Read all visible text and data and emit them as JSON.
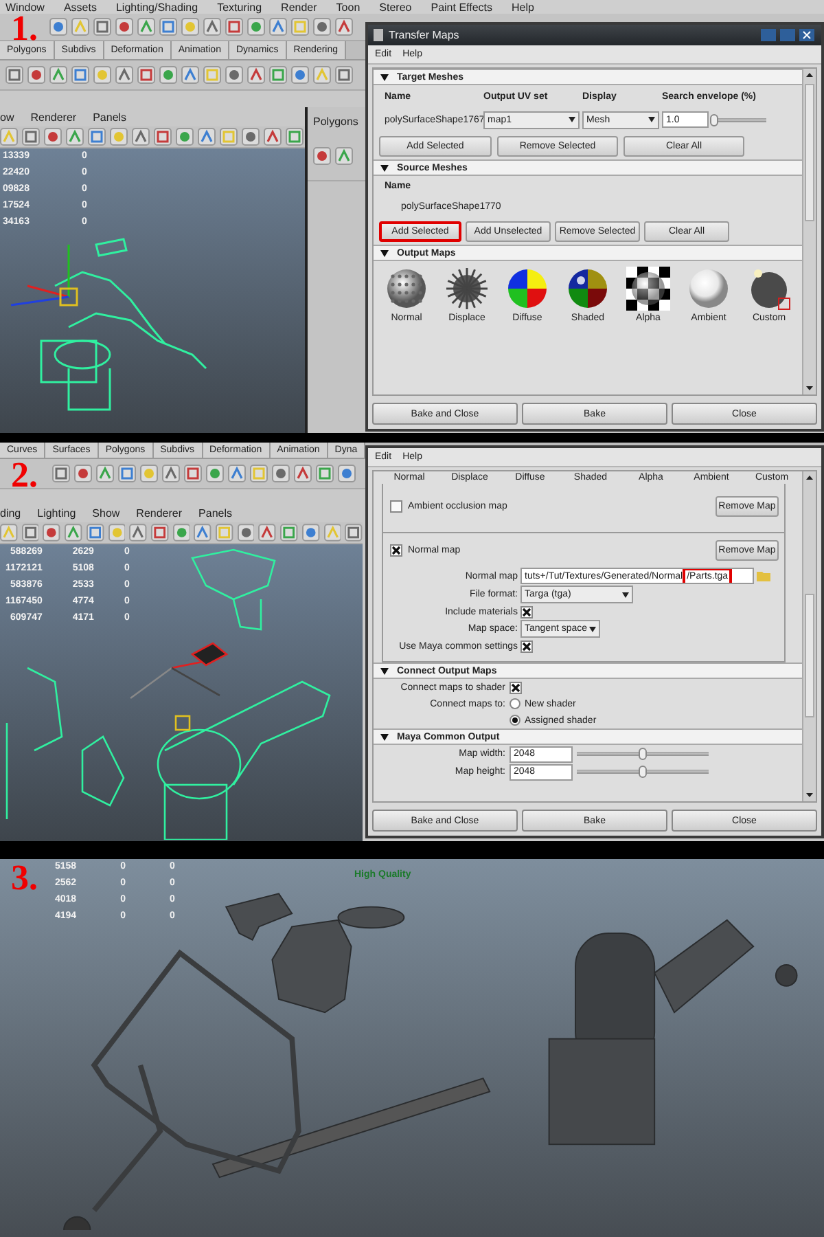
{
  "step_1": {
    "step": "1.",
    "menu_bar": [
      "Window",
      "Assets",
      "Lighting/Shading",
      "Texturing",
      "Render",
      "Toon",
      "Stereo",
      "Paint Effects",
      "Help"
    ],
    "shelf_tabs": [
      "Polygons",
      "Subdivs",
      "Deformation",
      "Animation",
      "Dynamics",
      "Rendering"
    ],
    "viewport_menu": [
      "ow",
      "Renderer",
      "Panels"
    ],
    "stats": [
      [
        "13339",
        "0"
      ],
      [
        "22420",
        "0"
      ],
      [
        "09828",
        "0"
      ],
      [
        "17524",
        "0"
      ],
      [
        "34163",
        "0"
      ]
    ],
    "side_panel": {
      "title": "Polygons"
    },
    "dialog": {
      "title": "Transfer Maps",
      "menu": [
        "Edit",
        "Help"
      ],
      "target": {
        "heading": "Target Meshes",
        "columns": [
          "Name",
          "Output UV set",
          "Display",
          "Search envelope (%)"
        ],
        "mesh": "polySurfaceShape1767",
        "uv_set": "map1",
        "display": "Mesh",
        "envelope": "1.0",
        "envelope_slider": {
          "level": 0.05
        },
        "buttons": [
          {
            "label": "Add Selected",
            "highlighted": false
          },
          {
            "label": "Remove Selected",
            "highlighted": false
          },
          {
            "label": "Clear All",
            "highlighted": false
          }
        ]
      },
      "source": {
        "heading": "Source Meshes",
        "column": "Name",
        "mesh": "polySurfaceShape1770",
        "buttons": [
          {
            "label": "Add Selected",
            "highlighted": true
          },
          {
            "label": "Add Unselected",
            "highlighted": false
          },
          {
            "label": "Remove Selected",
            "highlighted": false
          },
          {
            "label": "Clear All",
            "highlighted": false
          }
        ]
      },
      "output": {
        "heading": "Output Maps",
        "maps": [
          {
            "label": "Normal",
            "kind": "normal"
          },
          {
            "label": "Displace",
            "kind": "displace"
          },
          {
            "label": "Diffuse",
            "kind": "diffuse"
          },
          {
            "label": "Shaded",
            "kind": "shaded"
          },
          {
            "label": "Alpha",
            "kind": "alpha"
          },
          {
            "label": "Ambient",
            "kind": "ambient"
          },
          {
            "label": "Custom",
            "kind": "custom"
          }
        ]
      },
      "footer": [
        "Bake and Close",
        "Bake",
        "Close"
      ]
    }
  },
  "step_2": {
    "step": "2.",
    "shelf_tabs": [
      "Curves",
      "Surfaces",
      "Polygons",
      "Subdivs",
      "Deformation",
      "Animation",
      "Dyna"
    ],
    "viewport_menu": [
      "ding",
      "Lighting",
      "Show",
      "Renderer",
      "Panels"
    ],
    "stats": [
      [
        "588269",
        "2629",
        "0"
      ],
      [
        "1172121",
        "5108",
        "0"
      ],
      [
        "583876",
        "2533",
        "0"
      ],
      [
        "1167450",
        "4774",
        "0"
      ],
      [
        "609747",
        "4171",
        "0"
      ]
    ],
    "dialog": {
      "menu": [
        "Edit",
        "Help"
      ],
      "map_labels": [
        "Normal",
        "Displace",
        "Diffuse",
        "Shaded",
        "Alpha",
        "Ambient",
        "Custom"
      ],
      "maps": [
        {
          "label": "Ambient occlusion map",
          "checked": false,
          "button": "Remove Map"
        },
        {
          "label": "Normal map",
          "checked": true,
          "button": "Remove Map",
          "fields": [
            {
              "kind": "path",
              "label": "Normal map",
              "value": "tuts+/Tut/Textures/Generated/Normal",
              "highlight": "/Parts.tga"
            },
            {
              "kind": "select",
              "label": "File format:",
              "value": "Targa (tga)"
            },
            {
              "kind": "check",
              "label": "Include materials",
              "checked": true
            },
            {
              "kind": "select",
              "label": "Map space:",
              "value": "Tangent space"
            },
            {
              "kind": "check",
              "label": "Use Maya common settings",
              "checked": true
            }
          ]
        }
      ],
      "connect": {
        "heading": "Connect Output Maps",
        "shader_label": "Connect maps to shader",
        "shader_checked": true,
        "to_label": "Connect maps to:",
        "options": [
          {
            "label": "New shader",
            "selected": false
          },
          {
            "label": "Assigned shader",
            "selected": true
          }
        ]
      },
      "common": {
        "heading": "Maya Common Output",
        "rows": [
          {
            "label": "Map width:",
            "value": "2048",
            "level": 0.5
          },
          {
            "label": "Map height:",
            "value": "2048",
            "level": 0.5
          }
        ]
      },
      "footer": [
        "Bake and Close",
        "Bake",
        "Close"
      ]
    }
  },
  "step_3": {
    "step": "3.",
    "stats": [
      [
        "5158",
        "0",
        "0"
      ],
      [
        "2562",
        "0",
        "0"
      ],
      [
        "4018",
        "0",
        "0"
      ],
      [
        "4194",
        "0",
        "0"
      ]
    ],
    "quality_label": "High Quality"
  }
}
